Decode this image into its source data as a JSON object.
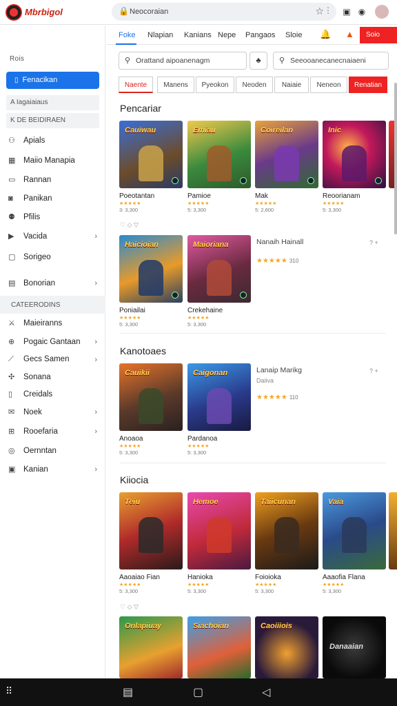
{
  "app": {
    "title": "Mbrbigol",
    "search": "Neocoraian"
  },
  "sidebar": {
    "head1": "Rois",
    "active": "Fenacikan",
    "band1": "A Iagaiaiaus",
    "band2": "K DE BEIDIRAEN",
    "items": [
      "Apials",
      "Maiio Manapia",
      "Rannan",
      "Panikan",
      "Pfilis",
      "Vacida",
      "Sorigeo"
    ],
    "item_extra": "Bonorian",
    "band3": "CATEERODINS",
    "cats": [
      "Maieiranns",
      "Pogaic Gantaan",
      "Gecs Samen",
      "Sonana",
      "Creidals",
      "Noek",
      "Rooefaria",
      "Oernntan",
      "Kanian"
    ]
  },
  "tabs": [
    "Foke",
    "Nlapian",
    "Kanians",
    "Nepe",
    "Pangaos",
    "Sloie"
  ],
  "red_button": "Soio",
  "search_left": "Orattand aipoanenagm",
  "search_right": "Seeooanecanecnaiaeni",
  "chips": [
    "Naente",
    "Manens",
    "Pyeokon",
    "Neoden",
    "Naiaie",
    "Neneon",
    "Renatian"
  ],
  "sections": [
    {
      "title": "Pencariar",
      "cards": [
        {
          "name": "Poeotantan",
          "label": "Cauiwau",
          "rating": "★★★★★",
          "price": "3: 3,300"
        },
        {
          "name": "Pamioe",
          "label": "Emiau",
          "rating": "★★★★★",
          "price": "5: 3,300"
        },
        {
          "name": "Mak",
          "label": "Coireilan",
          "rating": "★★★★★",
          "price": "5: 2,600"
        },
        {
          "name": "Reoorianam",
          "label": "Inic",
          "rating": "★★★★★",
          "price": "5: 3,300"
        }
      ],
      "more": "♡ ◇ ▽",
      "row2": [
        {
          "name": "Poniailai",
          "label": "Haicioian",
          "rating": "★★★★★",
          "price": "5: 3,300"
        },
        {
          "name": "Crekehaine",
          "label": "Maioriana",
          "rating": "★★★★★",
          "price": "5: 3,300"
        }
      ],
      "info": {
        "title": "Nanaih Hainall",
        "sub": "",
        "rating": "★★★★★",
        "count": "310",
        "side": "? +"
      }
    },
    {
      "title": "Kanotoaes",
      "cards": [
        {
          "name": "Anoaoa",
          "label": "Cauikii",
          "rating": "★★★★★",
          "price": "5: 3,300"
        },
        {
          "name": "Pardanoa",
          "label": "Caigonan",
          "rating": "★★★★★",
          "price": "5: 3,300"
        }
      ],
      "info": {
        "title": "Lanaip Marikg",
        "sub": "Daiiva",
        "rating": "★★★★★",
        "count": "110",
        "side": "? +"
      }
    },
    {
      "title": "Kiiocia",
      "cards": [
        {
          "name": "Aaoaiao Fian",
          "label": "Teiu",
          "rating": "★★★★★",
          "price": "5: 3,300"
        },
        {
          "name": "Hanioka",
          "label": "Hemoe",
          "rating": "★★★★★",
          "price": "5: 3,300"
        },
        {
          "name": "Foioioka",
          "label": "Taiicunan",
          "rating": "★★★★★",
          "price": "5: 3,300"
        },
        {
          "name": "Aaaofia Flana",
          "label": "Vaia",
          "rating": "★★★★★",
          "price": "5: 3,300"
        }
      ],
      "more": "♡ ◇ ▽",
      "row2": [
        {
          "label": "Onlapiuay"
        },
        {
          "label": "Siachoian"
        },
        {
          "label": "Caoiiiois"
        },
        {
          "label": "Danaaian"
        }
      ]
    }
  ]
}
